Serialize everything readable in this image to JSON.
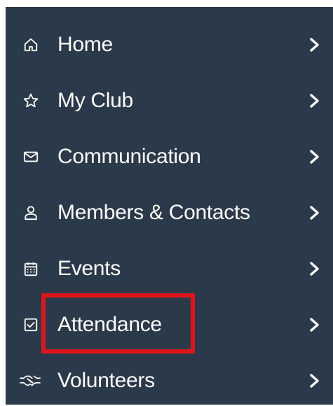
{
  "sidebar": {
    "items": [
      {
        "label": "Home",
        "icon": "home-icon"
      },
      {
        "label": "My Club",
        "icon": "star-icon"
      },
      {
        "label": "Communication",
        "icon": "envelope-icon"
      },
      {
        "label": "Members & Contacts",
        "icon": "user-icon"
      },
      {
        "label": "Events",
        "icon": "calendar-icon"
      },
      {
        "label": "Attendance",
        "icon": "checkbox-icon"
      },
      {
        "label": "Volunteers",
        "icon": "handshake-icon"
      }
    ]
  },
  "colors": {
    "sidebar_bg": "#2b3a4a",
    "text": "#ffffff",
    "highlight": "#e0141c"
  }
}
